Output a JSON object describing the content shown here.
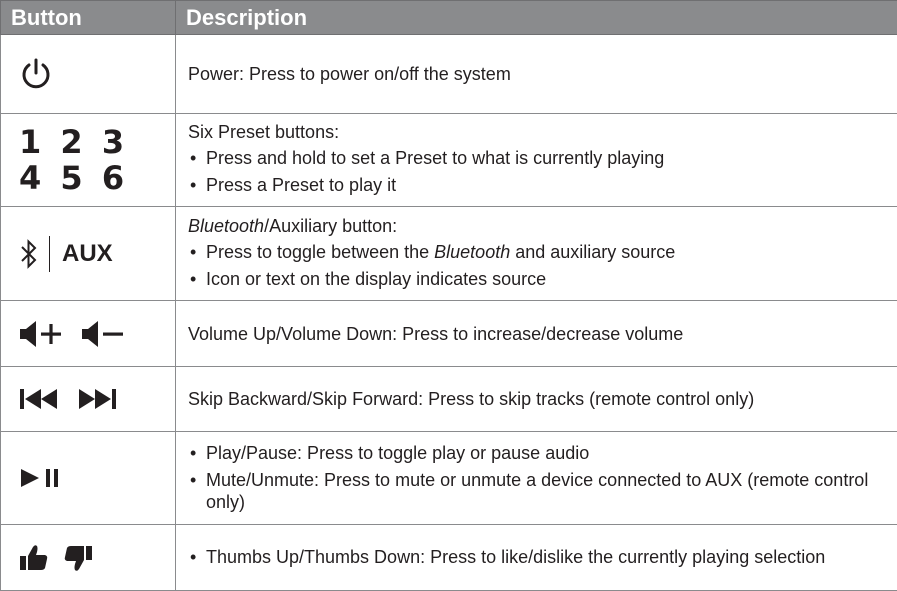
{
  "header": {
    "col_button": "Button",
    "col_description": "Description"
  },
  "rows": [
    {
      "id": "power",
      "icon": "power-icon",
      "text": "Power: Press to power on/off the system"
    },
    {
      "id": "presets",
      "icon": "preset-numbers",
      "preset_line1": "1 2 3",
      "preset_line2": "4 5 6",
      "intro": "Six Preset buttons:",
      "bullets": [
        "Press and hold to set a Preset to what is currently playing",
        "Press a Preset to play it"
      ]
    },
    {
      "id": "bluetooth-aux",
      "icon": "bluetooth-icon",
      "aux_label": "AUX",
      "intro_italic": "Bluetooth",
      "intro_rest": "/Auxiliary button:",
      "bullet1_pre": "Press to toggle between the ",
      "bullet1_italic": "Bluetooth",
      "bullet1_post": " and auxiliary source",
      "bullet2": "Icon or text on the display indicates source"
    },
    {
      "id": "volume",
      "icon": "volume-up-down-icon",
      "text": "Volume Up/Volume Down: Press to increase/decrease volume"
    },
    {
      "id": "skip",
      "icon": "skip-back-forward-icon",
      "text": "Skip Backward/Skip Forward: Press to skip tracks (remote control only)"
    },
    {
      "id": "play-pause",
      "icon": "play-pause-icon",
      "bullets": [
        "Play/Pause: Press to toggle play or pause audio",
        "Mute/Unmute: Press to mute or unmute a device connected to AUX (remote control only)"
      ]
    },
    {
      "id": "thumbs",
      "icon": "thumbs-up-down-icon",
      "bullets": [
        "Thumbs Up/Thumbs Down: Press to like/dislike the currently playing selection"
      ]
    }
  ]
}
